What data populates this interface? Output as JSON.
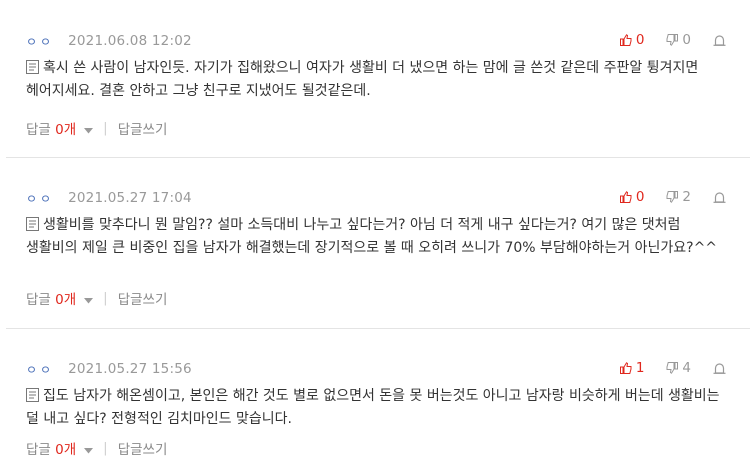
{
  "comments": [
    {
      "author": "ㅇㅇ",
      "date": "2021.06.08 12:02",
      "upvotes": "0",
      "downvotes": "0",
      "text": "혹시 쓴 사람이 남자인듯. 자기가 집해왔으니 여자가 생활비 더 냈으면 하는 맘에 글 쓴것 같은데 주판알 튕겨지면 헤어지세요. 결혼 안하고 그냥 친구로 지냈어도 될것같은데.",
      "reply_label": "답글",
      "reply_count": "0개",
      "write_reply": "답글쓰기"
    },
    {
      "author": "ㅇㅇ",
      "date": "2021.05.27 17:04",
      "upvotes": "0",
      "downvotes": "2",
      "text": "생활비를 맞추다니 뭔 말임?? 설마 소득대비 나누고 싶다는거? 아님 더 적게 내구 싶다는거? 여기 많은 댓처럼 생활비의 제일 큰 비중인 집을 남자가 해결했는데 장기적으로 볼 때 오히려 쓰니가 70% 부담해야하는거 아닌가요?^^",
      "reply_label": "답글",
      "reply_count": "0개",
      "write_reply": "답글쓰기"
    },
    {
      "author": "ㅇㅇ",
      "date": "2021.05.27 15:56",
      "upvotes": "1",
      "downvotes": "4",
      "text": "집도 남자가 해온셈이고, 본인은 해간 것도 별로 없으면서 돈을 못 버는것도 아니고 남자랑 비슷하게 버는데 생활비는 덜 내고 싶다? 전형적인 김치마인드 맞습니다.",
      "reply_label": "답글",
      "reply_count": "0개",
      "write_reply": "답글쓰기"
    }
  ],
  "colors": {
    "accent_red": "#e0281e",
    "author_blue": "#4a6fb8",
    "muted": "#999999"
  }
}
